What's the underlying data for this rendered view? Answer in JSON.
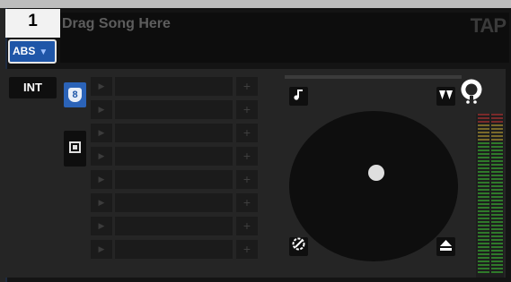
{
  "deck": {
    "number": "1",
    "song_placeholder": "Drag Song Here",
    "tap_label": "TAP",
    "mode_label": "ABS",
    "int_label": "INT"
  },
  "sampler": {
    "bank_label": "8",
    "rows": 8,
    "play_icon": "▶",
    "add_icon": "+"
  },
  "jog": {
    "music_icon": "music-note-icon",
    "speed_icon": "speed-icon",
    "key_icon": "key-icon",
    "eject_icon": "eject-icon"
  },
  "colors": {
    "accent": "#1f56a8",
    "meter_green": "#2f7a2a",
    "meter_red": "#7a2a2a",
    "meter_yellow": "#7a6a2a"
  }
}
